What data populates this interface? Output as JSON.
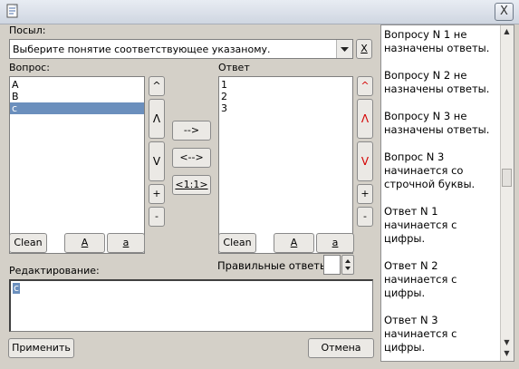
{
  "window": {
    "close_label": "X"
  },
  "message": {
    "label": "Посыл:",
    "selected": "Выберите понятие соответствующее указаному.",
    "clear_label": "X"
  },
  "question": {
    "label": "Вопрос:",
    "items": [
      "A",
      "B",
      "c"
    ],
    "selected_index": 2,
    "up_top": "^",
    "up": "Λ",
    "down": "V",
    "add": "+",
    "remove": "-",
    "clean": "Clean",
    "upper": "A",
    "lower": "a"
  },
  "mapping": {
    "forward": "-->",
    "both": "<-->",
    "one_to_one": "<1:1>"
  },
  "answer": {
    "label": "Ответ",
    "items": [
      "1",
      "2",
      "3"
    ],
    "up_top": "^",
    "up": "Λ",
    "down": "V",
    "add": "+",
    "remove": "-",
    "clean": "Clean",
    "upper": "A",
    "lower": "a",
    "correct_label": "Правильные ответь",
    "correct_value": ""
  },
  "editing": {
    "label": "Редактирование:",
    "value": "c"
  },
  "buttons": {
    "apply": "Применить",
    "cancel": "Отмена"
  },
  "warnings": [
    "Вопросу N 1 не назначены ответы.",
    "Вопросу N 2 не назначены ответы.",
    "Вопросу N 3 не назначены ответы.",
    "Вопрос N 3 начинается со строчной буквы.",
    "Ответ N 1 начинается с цифры.",
    "Ответ N 2 начинается с цифры.",
    "Ответ N 3 начинается с цифры."
  ]
}
